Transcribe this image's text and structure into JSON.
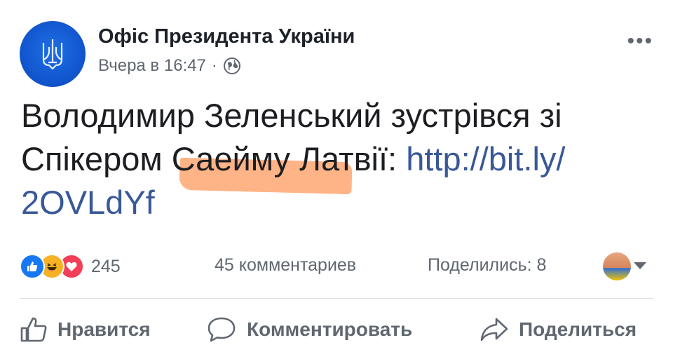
{
  "post": {
    "page_name": "Офіс Президента України",
    "timestamp": "Вчера в 16:47",
    "separator": "·",
    "text_line1": "Володимир Зеленський зустрівся зі",
    "text_line2_prefix": "Спікером Саейму Латвії: ",
    "link_part1": "http://bit.ly/",
    "link_part2": "2OVLdYf",
    "more_label": "•••"
  },
  "stats": {
    "reactions_count": "245",
    "comments_count": "45 комментариев",
    "shares_count": "Поделились: 8"
  },
  "actions": {
    "like": "Нравится",
    "comment": "Комментировать",
    "share": "Поделиться"
  },
  "colors": {
    "link": "#385898",
    "like_blue": "#1877f2",
    "haha_yellow": "#f7b125",
    "love_red": "#f33e58",
    "highlight_orange": "#ff8c46",
    "secondary_text": "#606770"
  },
  "icons": [
    "trident-icon",
    "globe-icon",
    "more-icon",
    "like-reaction-icon",
    "haha-reaction-icon",
    "love-reaction-icon",
    "thumbs-up-icon",
    "comment-icon",
    "share-icon"
  ]
}
